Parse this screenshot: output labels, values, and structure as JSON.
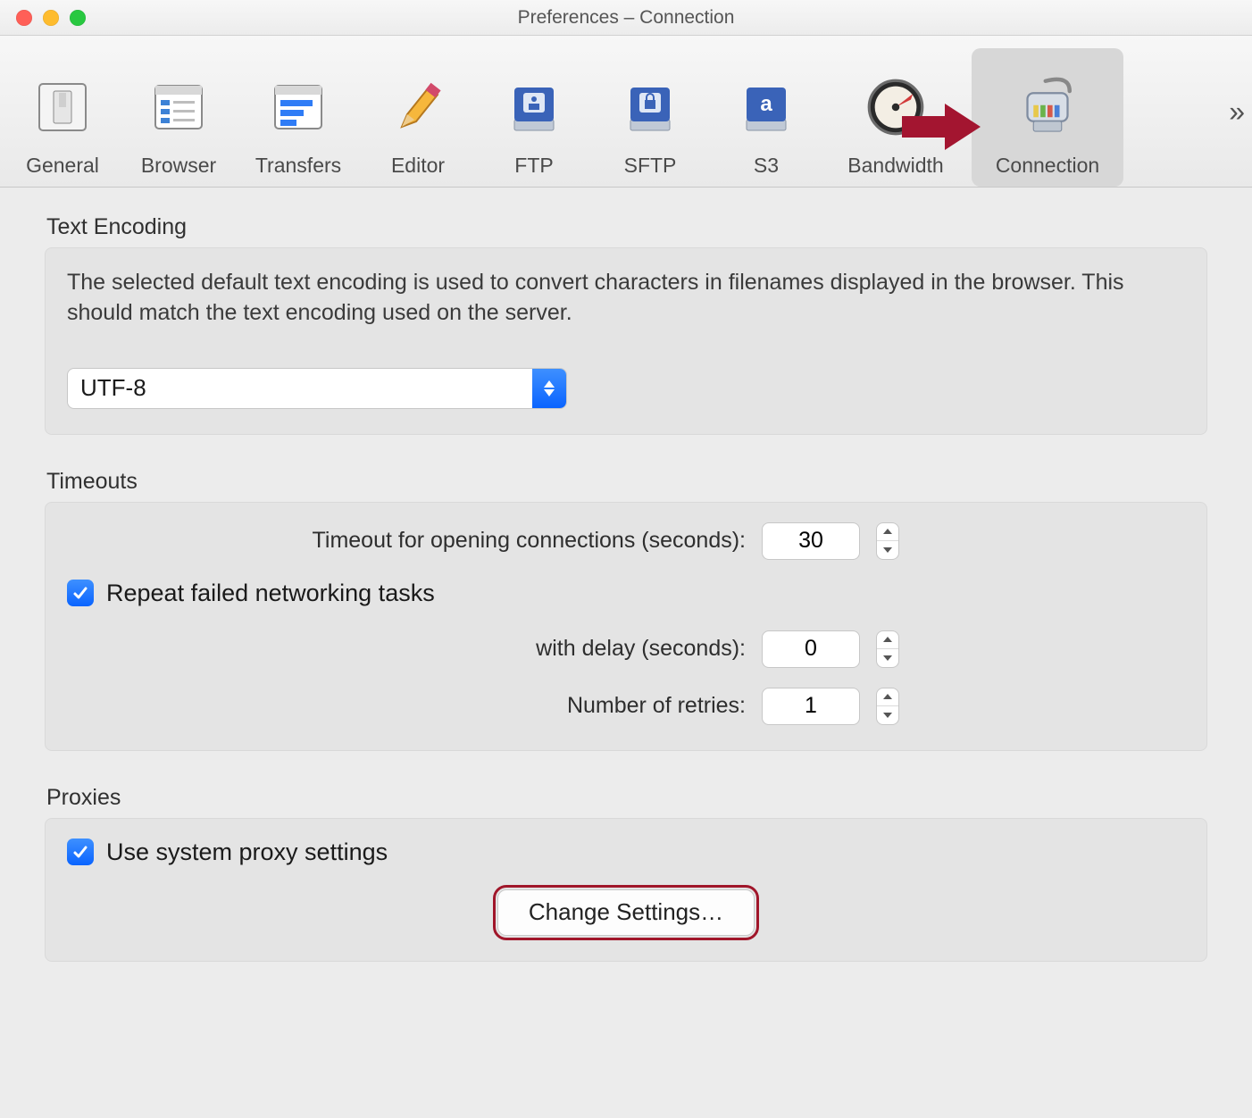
{
  "window": {
    "title": "Preferences – Connection"
  },
  "toolbar": {
    "items": [
      {
        "id": "general",
        "label": "General"
      },
      {
        "id": "browser",
        "label": "Browser"
      },
      {
        "id": "transfers",
        "label": "Transfers"
      },
      {
        "id": "editor",
        "label": "Editor"
      },
      {
        "id": "ftp",
        "label": "FTP"
      },
      {
        "id": "sftp",
        "label": "SFTP"
      },
      {
        "id": "s3",
        "label": "S3"
      },
      {
        "id": "bandwidth",
        "label": "Bandwidth"
      },
      {
        "id": "connection",
        "label": "Connection",
        "active": true
      }
    ],
    "overflow_glyph": "»"
  },
  "sections": {
    "encoding": {
      "title": "Text Encoding",
      "help": "The selected default text encoding is used to convert characters in filenames displayed in the browser. This should match the text encoding used on the server.",
      "select_value": "UTF-8"
    },
    "timeouts": {
      "title": "Timeouts",
      "timeout_label": "Timeout for opening connections (seconds):",
      "timeout_value": "30",
      "repeat_checkbox_label": "Repeat failed networking tasks",
      "repeat_checked": true,
      "delay_label": "with delay (seconds):",
      "delay_value": "0",
      "retries_label": "Number of retries:",
      "retries_value": "1"
    },
    "proxies": {
      "title": "Proxies",
      "use_system_label": "Use system proxy settings",
      "use_system_checked": true,
      "change_button_label": "Change Settings…"
    }
  }
}
